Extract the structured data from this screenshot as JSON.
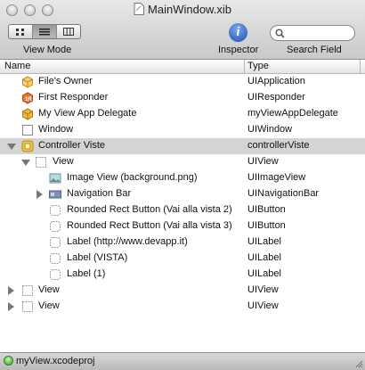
{
  "window": {
    "title": "MainWindow.xib"
  },
  "toolbar": {
    "view_mode_label": "View Mode",
    "inspector_label": "Inspector",
    "search_label": "Search Field",
    "search_value": "",
    "inspector_glyph": "i"
  },
  "columns": {
    "name": "Name",
    "type": "Type"
  },
  "rows": [
    {
      "name": "File's Owner",
      "type": "UIApplication",
      "icon": "cube-outline-icon"
    },
    {
      "name": "First Responder",
      "type": "UIResponder",
      "icon": "first-responder-icon"
    },
    {
      "name": "My View App Delegate",
      "type": "myViewAppDelegate",
      "icon": "object-cube-icon"
    },
    {
      "name": "Window",
      "type": "UIWindow",
      "icon": "window-icon"
    },
    {
      "name": "Controller Viste",
      "type": "controllerViste",
      "icon": "view-controller-icon"
    },
    {
      "name": "View",
      "type": "UIView",
      "icon": "view-icon"
    },
    {
      "name": "Image View (background.png)",
      "type": "UIImageView",
      "icon": "image-view-icon"
    },
    {
      "name": "Navigation Bar",
      "type": "UINavigationBar",
      "icon": "navigation-bar-icon"
    },
    {
      "name": "Rounded Rect Button (Vai alla vista 2)",
      "type": "UIButton",
      "icon": "button-icon"
    },
    {
      "name": "Rounded Rect Button (Vai alla vista 3)",
      "type": "UIButton",
      "icon": "button-icon"
    },
    {
      "name": "Label (http://www.devapp.it)",
      "type": "UILabel",
      "icon": "label-icon"
    },
    {
      "name": "Label (VISTA)",
      "type": "UILabel",
      "icon": "label-icon"
    },
    {
      "name": "Label (1)",
      "type": "UILabel",
      "icon": "label-icon"
    },
    {
      "name": "View",
      "type": "UIView",
      "icon": "view-icon"
    },
    {
      "name": "View",
      "type": "UIView",
      "icon": "view-icon"
    }
  ],
  "statusbar": {
    "project": "myView.xcodeproj"
  },
  "colors": {
    "selected_row": "#d4d4d4",
    "status_ok": "#2ea11e",
    "inspector_blue": "#1d4fb8"
  }
}
